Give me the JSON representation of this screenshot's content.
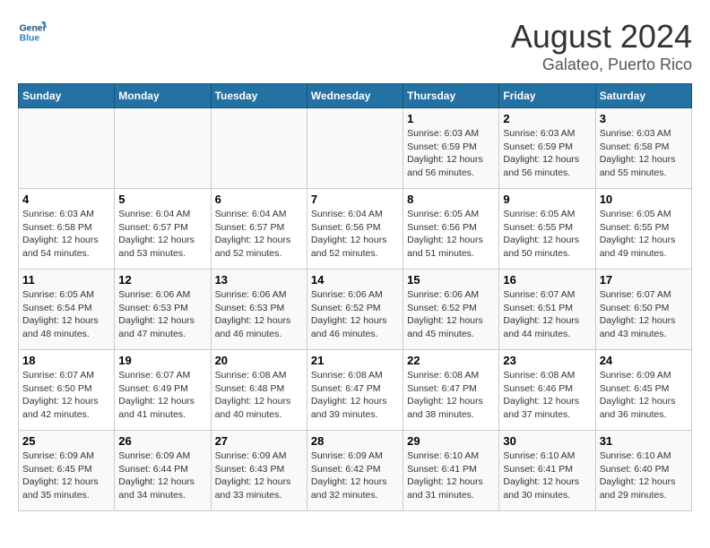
{
  "header": {
    "logo_line1": "General",
    "logo_line2": "Blue",
    "title": "August 2024",
    "subtitle": "Galateo, Puerto Rico"
  },
  "weekdays": [
    "Sunday",
    "Monday",
    "Tuesday",
    "Wednesday",
    "Thursday",
    "Friday",
    "Saturday"
  ],
  "weeks": [
    [
      {
        "day": "",
        "info": ""
      },
      {
        "day": "",
        "info": ""
      },
      {
        "day": "",
        "info": ""
      },
      {
        "day": "",
        "info": ""
      },
      {
        "day": "1",
        "info": "Sunrise: 6:03 AM\nSunset: 6:59 PM\nDaylight: 12 hours\nand 56 minutes."
      },
      {
        "day": "2",
        "info": "Sunrise: 6:03 AM\nSunset: 6:59 PM\nDaylight: 12 hours\nand 56 minutes."
      },
      {
        "day": "3",
        "info": "Sunrise: 6:03 AM\nSunset: 6:58 PM\nDaylight: 12 hours\nand 55 minutes."
      }
    ],
    [
      {
        "day": "4",
        "info": "Sunrise: 6:03 AM\nSunset: 6:58 PM\nDaylight: 12 hours\nand 54 minutes."
      },
      {
        "day": "5",
        "info": "Sunrise: 6:04 AM\nSunset: 6:57 PM\nDaylight: 12 hours\nand 53 minutes."
      },
      {
        "day": "6",
        "info": "Sunrise: 6:04 AM\nSunset: 6:57 PM\nDaylight: 12 hours\nand 52 minutes."
      },
      {
        "day": "7",
        "info": "Sunrise: 6:04 AM\nSunset: 6:56 PM\nDaylight: 12 hours\nand 52 minutes."
      },
      {
        "day": "8",
        "info": "Sunrise: 6:05 AM\nSunset: 6:56 PM\nDaylight: 12 hours\nand 51 minutes."
      },
      {
        "day": "9",
        "info": "Sunrise: 6:05 AM\nSunset: 6:55 PM\nDaylight: 12 hours\nand 50 minutes."
      },
      {
        "day": "10",
        "info": "Sunrise: 6:05 AM\nSunset: 6:55 PM\nDaylight: 12 hours\nand 49 minutes."
      }
    ],
    [
      {
        "day": "11",
        "info": "Sunrise: 6:05 AM\nSunset: 6:54 PM\nDaylight: 12 hours\nand 48 minutes."
      },
      {
        "day": "12",
        "info": "Sunrise: 6:06 AM\nSunset: 6:53 PM\nDaylight: 12 hours\nand 47 minutes."
      },
      {
        "day": "13",
        "info": "Sunrise: 6:06 AM\nSunset: 6:53 PM\nDaylight: 12 hours\nand 46 minutes."
      },
      {
        "day": "14",
        "info": "Sunrise: 6:06 AM\nSunset: 6:52 PM\nDaylight: 12 hours\nand 46 minutes."
      },
      {
        "day": "15",
        "info": "Sunrise: 6:06 AM\nSunset: 6:52 PM\nDaylight: 12 hours\nand 45 minutes."
      },
      {
        "day": "16",
        "info": "Sunrise: 6:07 AM\nSunset: 6:51 PM\nDaylight: 12 hours\nand 44 minutes."
      },
      {
        "day": "17",
        "info": "Sunrise: 6:07 AM\nSunset: 6:50 PM\nDaylight: 12 hours\nand 43 minutes."
      }
    ],
    [
      {
        "day": "18",
        "info": "Sunrise: 6:07 AM\nSunset: 6:50 PM\nDaylight: 12 hours\nand 42 minutes."
      },
      {
        "day": "19",
        "info": "Sunrise: 6:07 AM\nSunset: 6:49 PM\nDaylight: 12 hours\nand 41 minutes."
      },
      {
        "day": "20",
        "info": "Sunrise: 6:08 AM\nSunset: 6:48 PM\nDaylight: 12 hours\nand 40 minutes."
      },
      {
        "day": "21",
        "info": "Sunrise: 6:08 AM\nSunset: 6:47 PM\nDaylight: 12 hours\nand 39 minutes."
      },
      {
        "day": "22",
        "info": "Sunrise: 6:08 AM\nSunset: 6:47 PM\nDaylight: 12 hours\nand 38 minutes."
      },
      {
        "day": "23",
        "info": "Sunrise: 6:08 AM\nSunset: 6:46 PM\nDaylight: 12 hours\nand 37 minutes."
      },
      {
        "day": "24",
        "info": "Sunrise: 6:09 AM\nSunset: 6:45 PM\nDaylight: 12 hours\nand 36 minutes."
      }
    ],
    [
      {
        "day": "25",
        "info": "Sunrise: 6:09 AM\nSunset: 6:45 PM\nDaylight: 12 hours\nand 35 minutes."
      },
      {
        "day": "26",
        "info": "Sunrise: 6:09 AM\nSunset: 6:44 PM\nDaylight: 12 hours\nand 34 minutes."
      },
      {
        "day": "27",
        "info": "Sunrise: 6:09 AM\nSunset: 6:43 PM\nDaylight: 12 hours\nand 33 minutes."
      },
      {
        "day": "28",
        "info": "Sunrise: 6:09 AM\nSunset: 6:42 PM\nDaylight: 12 hours\nand 32 minutes."
      },
      {
        "day": "29",
        "info": "Sunrise: 6:10 AM\nSunset: 6:41 PM\nDaylight: 12 hours\nand 31 minutes."
      },
      {
        "day": "30",
        "info": "Sunrise: 6:10 AM\nSunset: 6:41 PM\nDaylight: 12 hours\nand 30 minutes."
      },
      {
        "day": "31",
        "info": "Sunrise: 6:10 AM\nSunset: 6:40 PM\nDaylight: 12 hours\nand 29 minutes."
      }
    ]
  ]
}
